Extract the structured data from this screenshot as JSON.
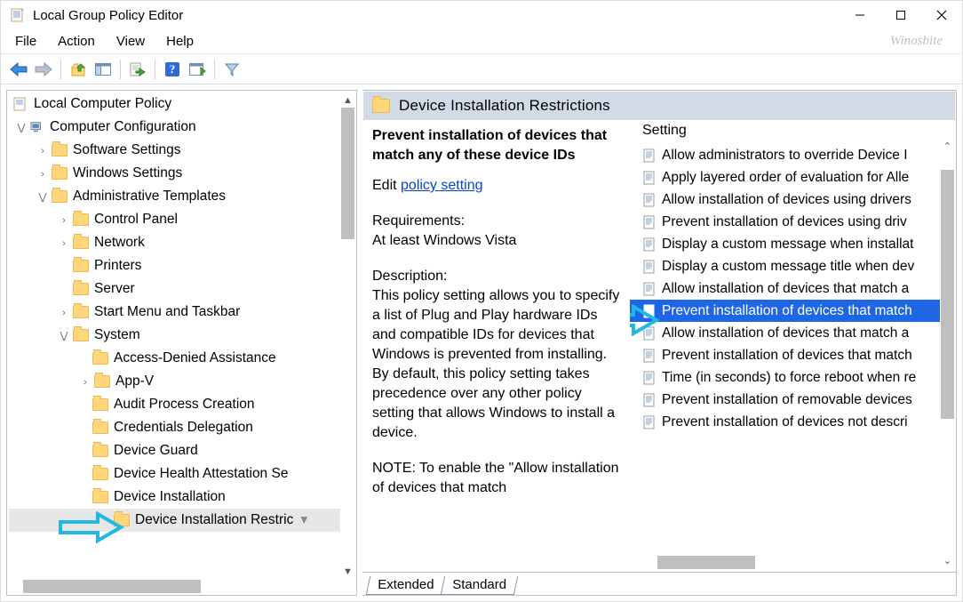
{
  "window": {
    "title": "Local Group Policy Editor"
  },
  "watermark": "Winosbite",
  "menubar": [
    "File",
    "Action",
    "View",
    "Help"
  ],
  "tree": {
    "root": "Local Computer Policy",
    "config": "Computer Configuration",
    "software": "Software Settings",
    "windows": "Windows Settings",
    "adm": "Administrative Templates",
    "cp": "Control Panel",
    "net": "Network",
    "prn": "Printers",
    "srv": "Server",
    "start": "Start Menu and Taskbar",
    "sys": "System",
    "s1": "Access-Denied Assistance",
    "s2": "App-V",
    "s3": "Audit Process Creation",
    "s4": "Credentials Delegation",
    "s5": "Device Guard",
    "s6": "Device Health Attestation Se",
    "s7": "Device Installation",
    "s8": "Device Installation Restric"
  },
  "right": {
    "header": "Device Installation Restrictions",
    "policy_title": "Prevent installation of devices that match any of these device IDs",
    "edit_prefix": "Edit ",
    "edit_link": "policy setting",
    "req_label": "Requirements:",
    "req_text": "At least Windows Vista",
    "desc_label": "Description:",
    "desc_text": "This policy setting allows you to specify a list of Plug and Play hardware IDs and compatible IDs for devices that Windows is prevented from installing. By default, this policy setting takes precedence over any other policy setting that allows Windows to install a device.",
    "desc_note": "NOTE: To enable the \"Allow installation of devices that match"
  },
  "settings_col": "Setting",
  "settings": [
    "Allow administrators to override Device I",
    "Apply layered order of evaluation for Alle",
    "Allow installation of devices using drivers",
    "Prevent installation of devices using driv",
    "Display a custom message when installat",
    "Display a custom message title when dev",
    "Allow installation of devices that match a",
    "Prevent installation of devices that match",
    "Allow installation of devices that match a",
    "Prevent installation of devices that match",
    "Time (in seconds) to force reboot when re",
    "Prevent installation of removable devices",
    "Prevent installation of devices not descri"
  ],
  "tabs": {
    "extended": "Extended",
    "standard": "Standard"
  }
}
